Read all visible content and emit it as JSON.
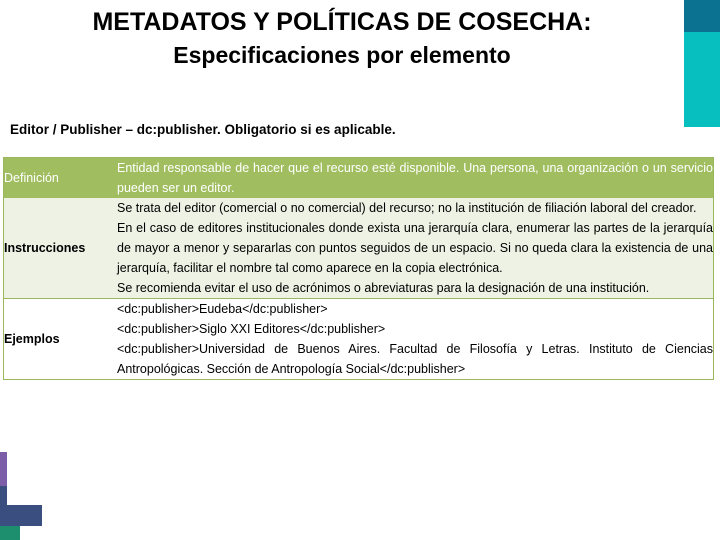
{
  "slide": {
    "title_line_1": "METADATOS Y POLÍTICAS DE COSECHA:",
    "title_line_2": "Especificaciones por elemento",
    "subtitle": "Editor / Publisher – dc:publisher. Obligatorio si es aplicable."
  },
  "colors": {
    "header_green": "#A0BE5F",
    "row_light": "#EEF2E5",
    "border_olive": "#9BB75D",
    "teal_dark": "#0B7391",
    "teal_light": "#08BFC0",
    "accent_blue": "#3A4F80",
    "accent_green": "#1E8F6E",
    "accent_purple": "#7B5EA7"
  },
  "table": {
    "rows": [
      {
        "label": "Definición",
        "paragraphs": [
          "Entidad responsable de hacer que el recurso esté disponible. Una persona, una organización o un servicio pueden ser un editor."
        ]
      },
      {
        "label": "",
        "paragraphs": [
          "Se trata del editor (comercial o no comercial) del recurso; no la institución de filiación laboral del creador."
        ]
      },
      {
        "label": "Instrucciones",
        "paragraphs": [
          "En el caso de editores institucionales donde exista una jerarquía clara, enumerar las partes de la jerarquía de mayor a menor y separarlas con puntos seguidos de un espacio. Si no queda clara la existencia de una jerarquía, facilitar el nombre tal como aparece en la copia electrónica."
        ]
      },
      {
        "label": "",
        "paragraphs": [
          "Se recomienda evitar el uso de acrónimos o abreviaturas para la designación de una institución."
        ]
      },
      {
        "label": "Ejemplos",
        "examples": [
          "<dc:publisher>Eudeba</dc:publisher>",
          "<dc:publisher>Siglo XXI Editores</dc:publisher>",
          "<dc:publisher>Universidad de Buenos Aires. Facultad de Filosofía y Letras. Instituto de Ciencias Antropológicas. Sección de Antropología Social</dc:publisher>"
        ]
      }
    ]
  }
}
